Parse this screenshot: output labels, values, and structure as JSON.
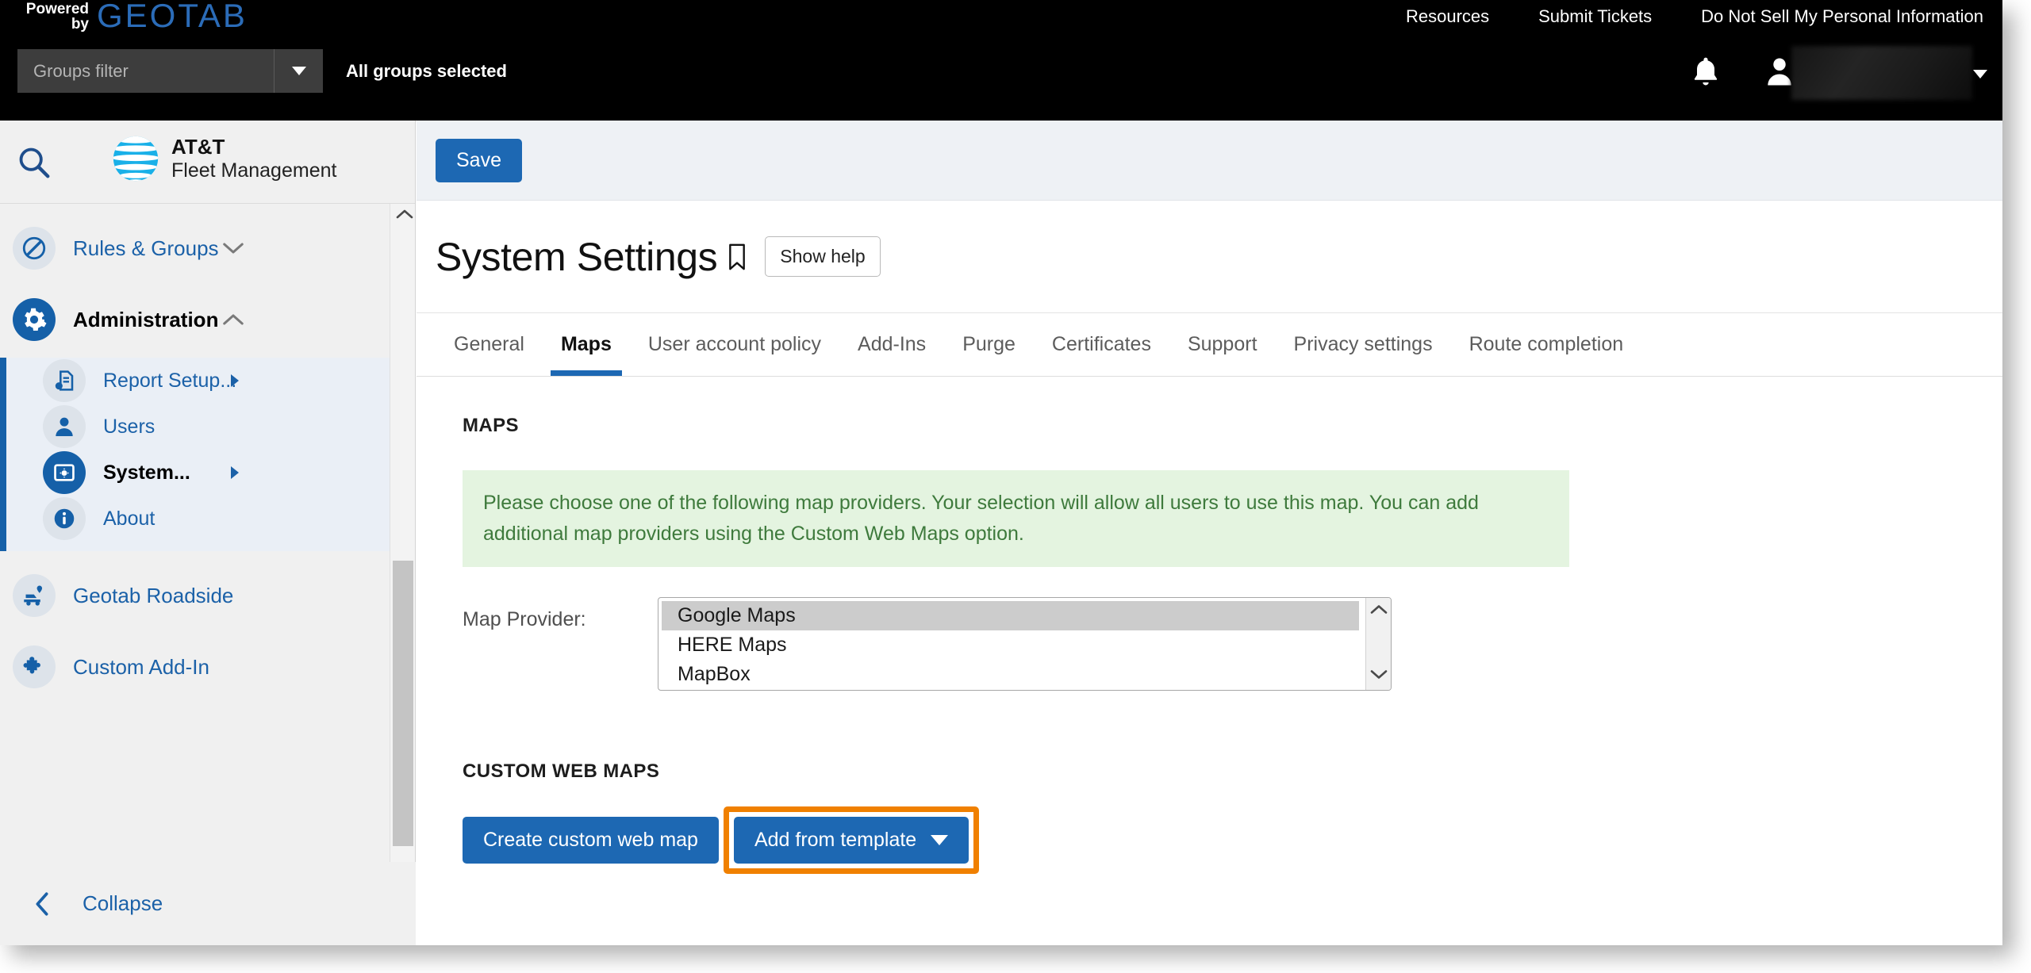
{
  "topbar": {
    "powered_line1": "Powered",
    "powered_line2": "by",
    "brand": "GEOTAB",
    "nav": [
      {
        "label": "Resources"
      },
      {
        "label": "Submit Tickets"
      },
      {
        "label": "Do Not Sell My Personal Information"
      }
    ],
    "groups_filter_placeholder": "Groups filter",
    "groups_selected_text": "All groups selected",
    "bell_icon": "bell-icon",
    "user_icon": "user-avatar-icon",
    "user_name": "",
    "user_caret_icon": "caret-down-icon"
  },
  "sidebar": {
    "search_icon": "search-icon",
    "brand_line1": "AT&T",
    "brand_line2": "Fleet Management",
    "items": [
      {
        "label": "Rules & Groups",
        "icon": "rules-groups-icon",
        "chevron": "chevron-down-icon"
      },
      {
        "label": "Administration",
        "icon": "gear-icon",
        "chevron": "chevron-up-icon"
      }
    ],
    "sub_items": [
      {
        "label": "Report Setup...",
        "icon": "report-setup-icon",
        "arrow": "arrow-right-icon"
      },
      {
        "label": "Users",
        "icon": "user-icon",
        "arrow": ""
      },
      {
        "label": "System...",
        "icon": "system-settings-icon",
        "arrow": "arrow-right-icon"
      },
      {
        "label": "About",
        "icon": "info-icon",
        "arrow": ""
      }
    ],
    "extra_items": [
      {
        "label": "Geotab Roadside",
        "icon": "roadside-truck-icon"
      },
      {
        "label": "Custom Add-In",
        "icon": "puzzle-piece-icon"
      }
    ],
    "collapse_label": "Collapse",
    "collapse_icon": "chevron-left-icon"
  },
  "toolbar": {
    "save_label": "Save"
  },
  "page": {
    "title": "System Settings",
    "bookmark_icon": "bookmark-icon",
    "show_help_label": "Show help"
  },
  "tabs": [
    {
      "label": "General",
      "active": false
    },
    {
      "label": "Maps",
      "active": true
    },
    {
      "label": "User account policy",
      "active": false
    },
    {
      "label": "Add-Ins",
      "active": false
    },
    {
      "label": "Purge",
      "active": false
    },
    {
      "label": "Certificates",
      "active": false
    },
    {
      "label": "Support",
      "active": false
    },
    {
      "label": "Privacy settings",
      "active": false
    },
    {
      "label": "Route completion",
      "active": false
    }
  ],
  "maps_section": {
    "heading": "MAPS",
    "info_text": "Please choose one of the following map providers. Your selection will allow all users to use this map. You can add additional map providers using the Custom Web Maps option.",
    "provider_label": "Map Provider:",
    "providers": [
      {
        "label": "Google Maps",
        "selected": true
      },
      {
        "label": "HERE Maps",
        "selected": false
      },
      {
        "label": "MapBox",
        "selected": false
      }
    ],
    "scroll_up_icon": "chevron-up-icon",
    "scroll_down_icon": "chevron-down-icon"
  },
  "custom_web_maps": {
    "heading": "CUSTOM WEB MAPS",
    "create_label": "Create custom web map",
    "template_label": "Add from template",
    "template_caret_icon": "caret-down-icon",
    "highlight_color": "#f08000"
  },
  "colors": {
    "brand_blue": "#1d68b3",
    "geotab_blue": "#2b6cb8",
    "att_cyan": "#22a3dd",
    "info_green_bg": "#e4f4e0",
    "info_green_text": "#3e7a3c",
    "highlight_orange": "#f08000",
    "topbar_black": "#000000",
    "sidebar_bg": "#f0f0f0"
  }
}
